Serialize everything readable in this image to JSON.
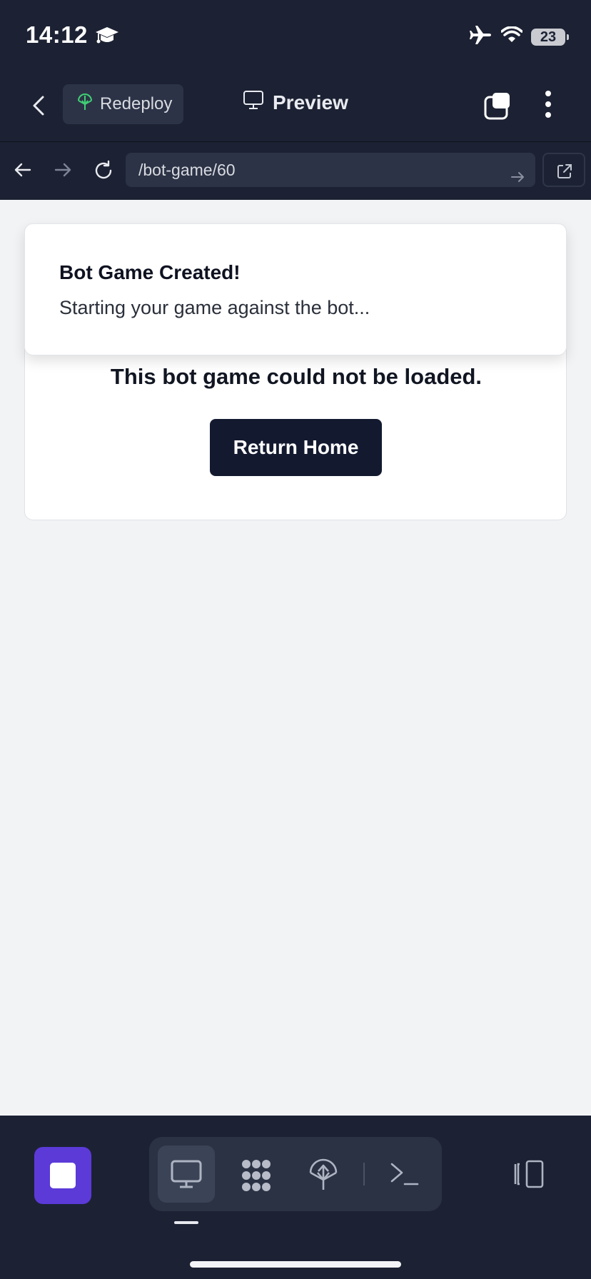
{
  "status_bar": {
    "time": "14:12",
    "battery": "23"
  },
  "header": {
    "redeploy_label": "Redeploy",
    "preview_label": "Preview"
  },
  "url_bar": {
    "path": "/bot-game/60"
  },
  "page": {
    "error_message": "This bot game could not be loaded.",
    "return_button": "Return Home"
  },
  "toast": {
    "title": "Bot Game Created!",
    "description": "Starting your game against the bot..."
  },
  "colors": {
    "accent": "#5b3ad8",
    "chrome_bg": "#1c2233",
    "button_bg": "#131a30",
    "page_bg": "#f2f3f5"
  },
  "icons": [
    "graduation-cap-icon",
    "airplane-icon",
    "wifi-icon",
    "battery-icon",
    "back-chevron-icon",
    "redeploy-icon",
    "monitor-icon",
    "tabs-icon",
    "more-vertical-icon",
    "arrow-left-icon",
    "arrow-right-icon",
    "reload-icon",
    "go-arrow-icon",
    "external-link-icon",
    "stop-icon",
    "preview-tool-icon",
    "dots-cluster-icon",
    "deploy-tool-icon",
    "terminal-icon",
    "panel-toggle-icon"
  ]
}
